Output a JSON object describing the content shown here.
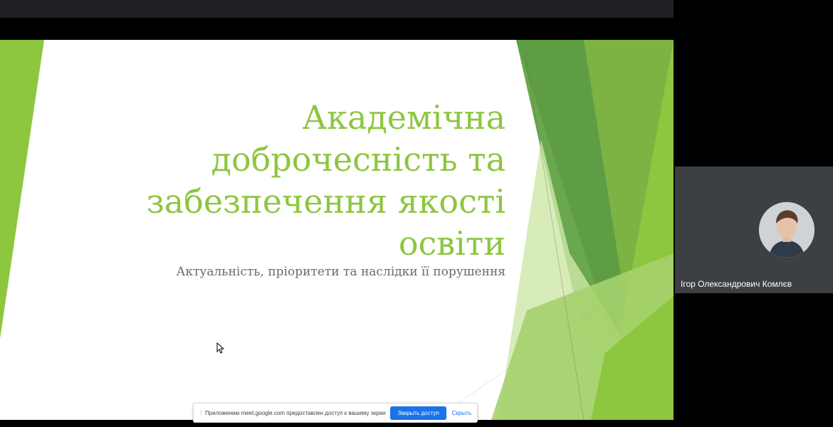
{
  "slide": {
    "title_lines": [
      "Академічна",
      "доброчесність та",
      "забезпечення якості",
      "освіти"
    ],
    "subtitle": "Актуальність, пріоритети та наслідки її порушення",
    "accent_color": "#8dc63f"
  },
  "participant": {
    "name": "Ігор Олександрович Комлєв"
  },
  "share_bar": {
    "message": "Приложению meet.google.com предоставлен доступ к вашему экрану.",
    "stop_label": "Закрыть доступ",
    "hide_label": "Скрыть"
  },
  "icons": {
    "cursor": "mouse-cursor-icon",
    "grip": "drag-handle-icon"
  }
}
